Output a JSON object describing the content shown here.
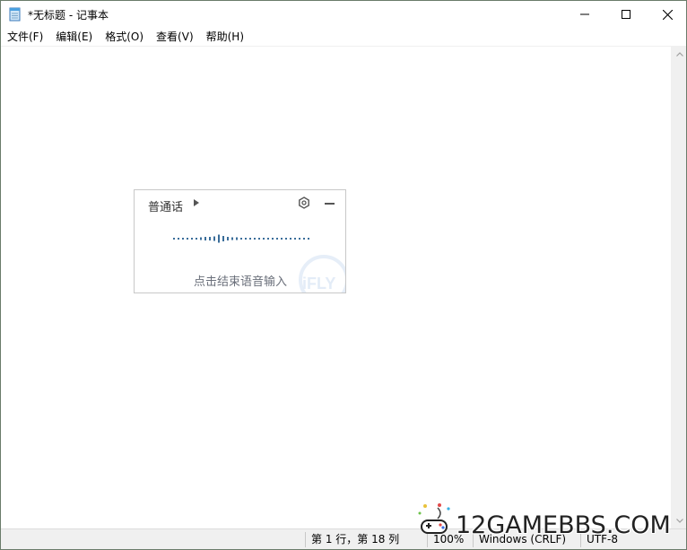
{
  "window": {
    "title": "*无标题 - 记事本",
    "controls": {
      "minimize": "minimize",
      "maximize": "maximize",
      "close": "close"
    }
  },
  "menu": {
    "items": [
      "文件(F)",
      "编辑(E)",
      "格式(O)",
      "查看(V)",
      "帮助(H)"
    ]
  },
  "editor": {
    "content": ""
  },
  "statusbar": {
    "position": "第 1 行，第 18 列",
    "zoom": "100%",
    "line_ending": "Windows (CRLF)",
    "encoding": "UTF-8"
  },
  "voice_input": {
    "language": "普通话",
    "hint": "点击结束语音输入",
    "brand": "iFLY",
    "icons": [
      "dropdown-arrow-icon",
      "settings-gear-icon",
      "minimize-icon"
    ]
  },
  "watermark": {
    "text": "12GAMEBBS.COM"
  },
  "colors": {
    "wave_bar": "#3a6d9a",
    "hint_text": "#6a6f7a",
    "statusbar_bg": "#f0f0f0"
  }
}
